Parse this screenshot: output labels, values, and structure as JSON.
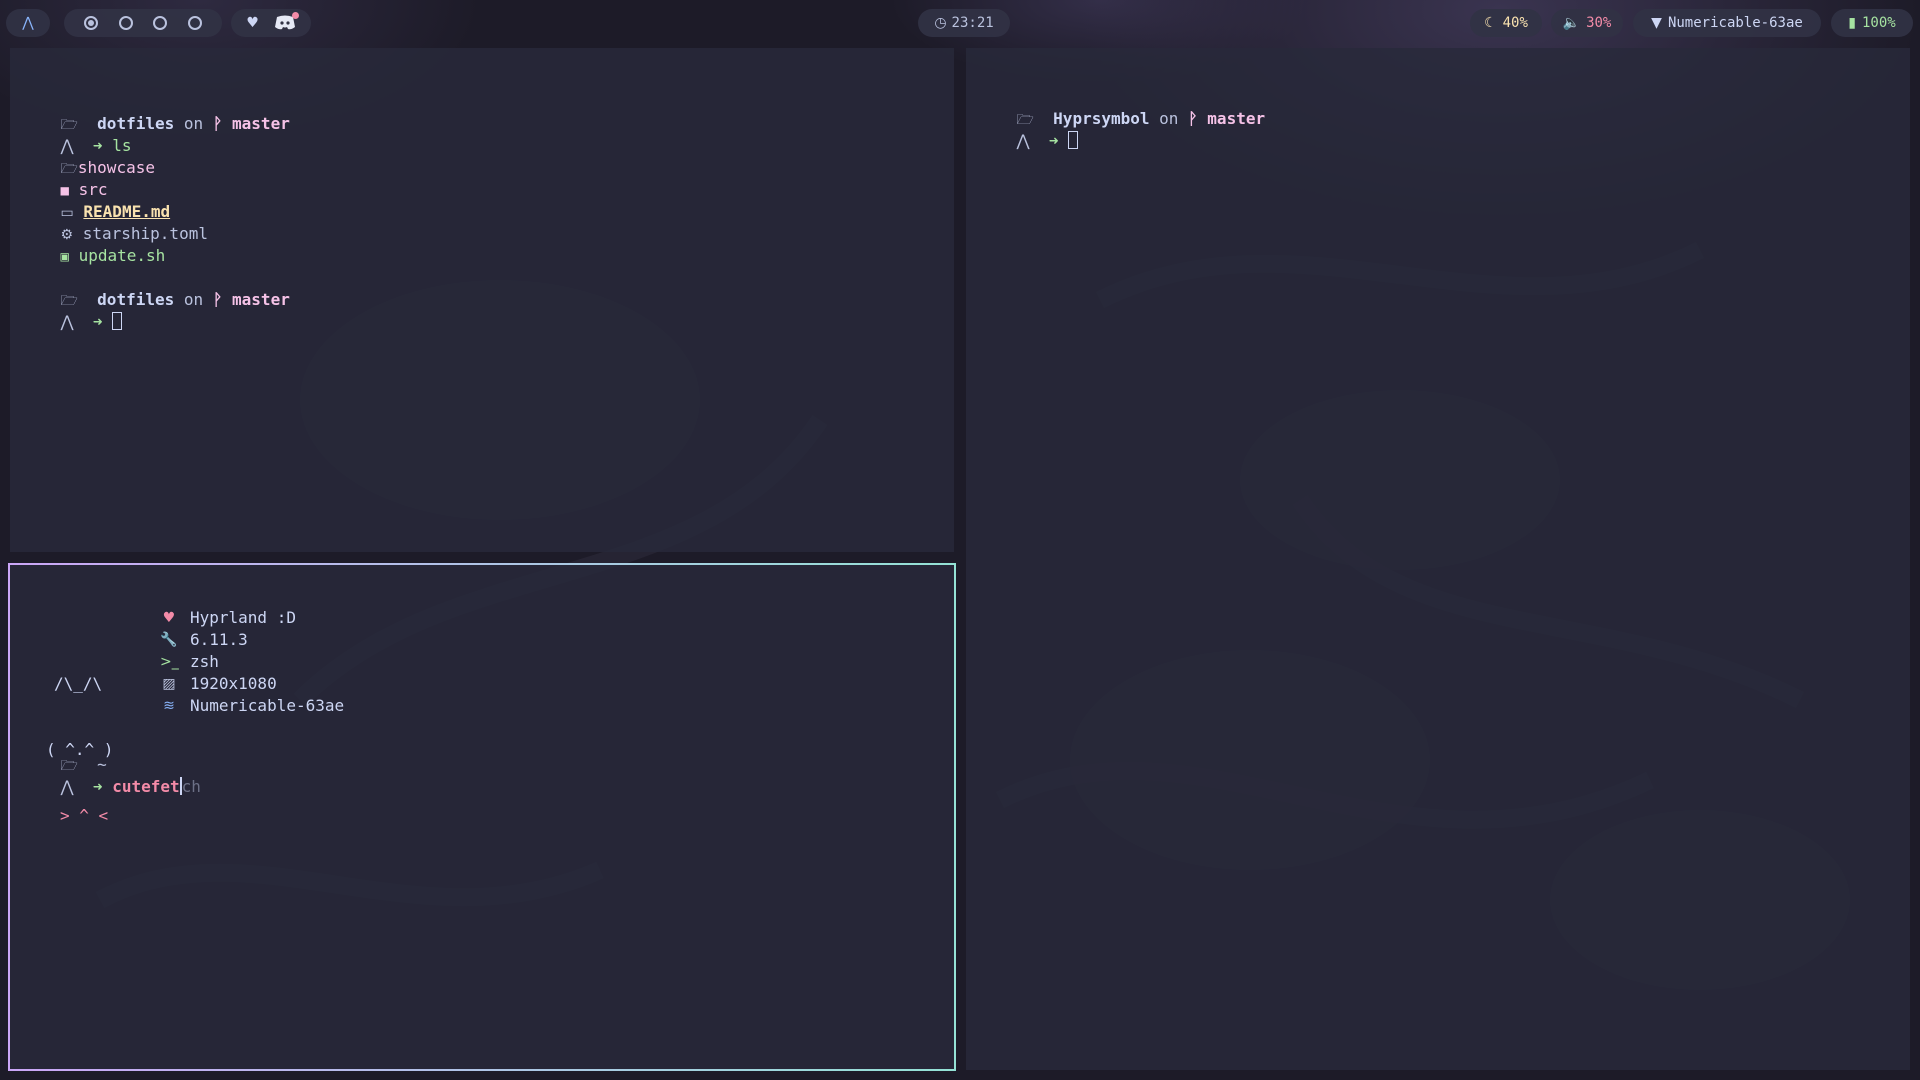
{
  "topbar": {
    "clock": "23:21",
    "brightness": "40%",
    "volume": "30%",
    "network": "Numericable-63ae",
    "battery": "100%",
    "workspaces": [
      {
        "active": true
      },
      {
        "active": false
      },
      {
        "active": false
      },
      {
        "active": false
      }
    ]
  },
  "term1": {
    "prompt1": {
      "dir": "dotfiles",
      "on": "on",
      "branch": "master",
      "cmd": "ls"
    },
    "files": [
      "showcase",
      "src",
      "README.md",
      "starship.toml",
      "update.sh"
    ],
    "prompt2": {
      "dir": "dotfiles",
      "on": "on",
      "branch": "master"
    }
  },
  "term2": {
    "prompt": {
      "dir": "Hyprsymbol",
      "on": "on",
      "branch": "master"
    }
  },
  "term3": {
    "ascii": [
      "/\\_/\\",
      "( ^.^ )",
      "> ^ <"
    ],
    "info": {
      "wm": "Hyprland :D",
      "kernel": "6.11.3",
      "shell": "zsh",
      "resolution": "1920x1080",
      "network": "Numericable-63ae"
    },
    "cwd": "~",
    "typed": "cutefet",
    "suggestion": "ch"
  },
  "colors": {
    "accent": "#89b4fa",
    "branch": "#f5c2e7",
    "prompt_arrow": "#a6e3a1",
    "border_start": "#cba6f7",
    "border_end": "#94e2d5"
  }
}
